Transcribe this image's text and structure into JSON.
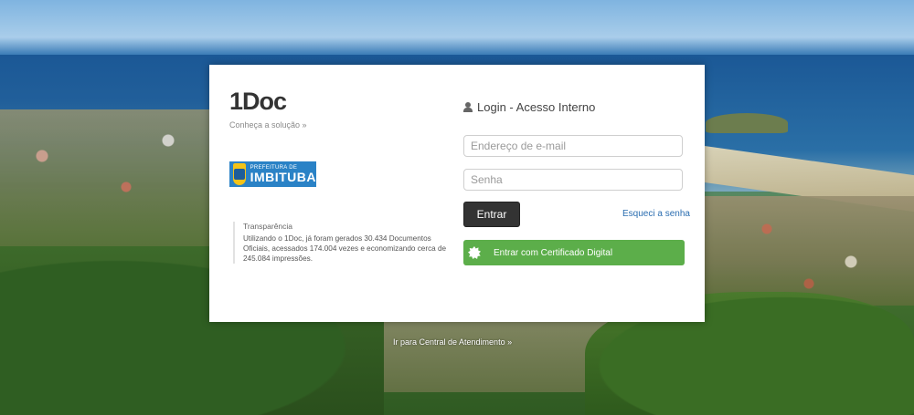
{
  "brand": {
    "name": "1Doc",
    "solution_link": "Conheça a solução »"
  },
  "prefeitura": {
    "line1": "PREFEITURA DE",
    "line2": "IMBITUBA"
  },
  "transparency": {
    "title": "Transparência",
    "text": "Utilizando o 1Doc, já foram gerados 30.434 Documentos Oficiais, acessados 174.004 vezes e economizando cerca de 245.084 impressões."
  },
  "login": {
    "title": "Login - Acesso Interno",
    "email_placeholder": "Endereço de e-mail",
    "password_placeholder": "Senha",
    "submit_label": "Entrar",
    "forgot_label": "Esqueci a senha",
    "certificate_label": "Entrar com Certificado Digital"
  },
  "footer": {
    "central_link": "Ir para Central de Atendimento »"
  },
  "colors": {
    "certificate_button": "#5cae4a",
    "submit_button": "#333333",
    "link": "#2a6db0"
  }
}
